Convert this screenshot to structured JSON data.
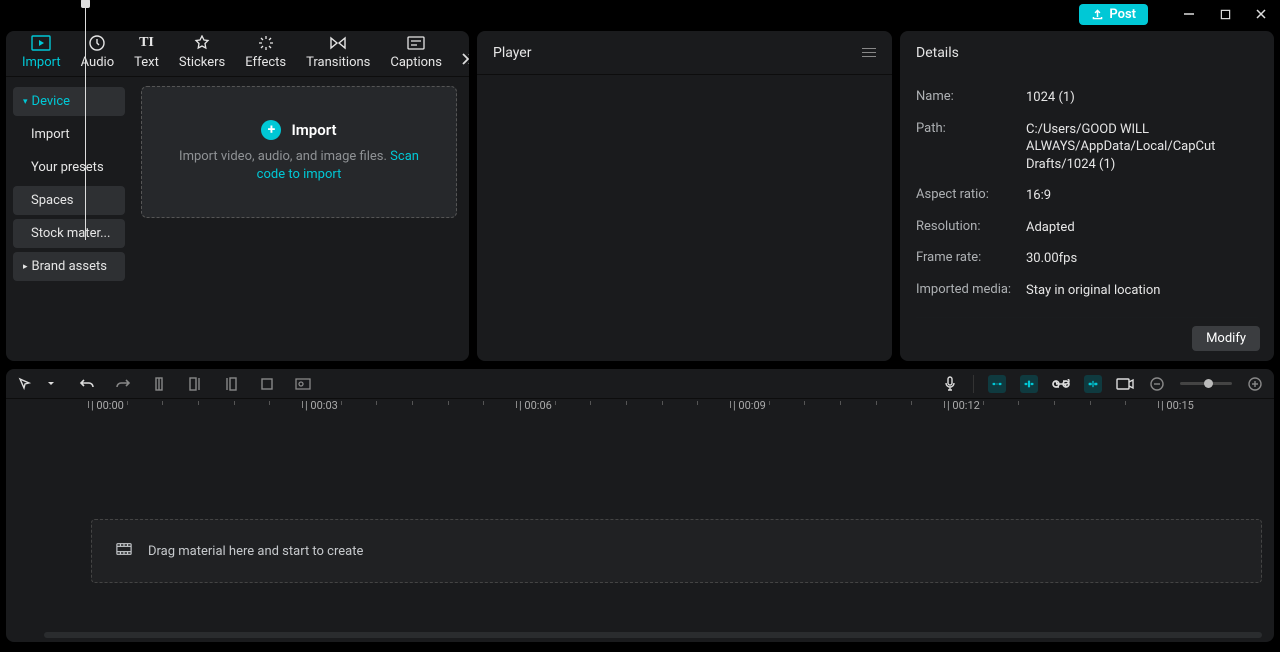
{
  "titlebar": {
    "post": "Post"
  },
  "tabs": {
    "import": "Import",
    "audio": "Audio",
    "text": "Text",
    "stickers": "Stickers",
    "effects": "Effects",
    "transitions": "Transitions",
    "captions": "Captions"
  },
  "sidenav": {
    "device": "Device",
    "import": "Import",
    "presets": "Your presets",
    "spaces": "Spaces",
    "stock": "Stock mater...",
    "brand": "Brand assets"
  },
  "importBox": {
    "title": "Import",
    "hint_prefix": "Import video, audio, and image files. ",
    "hint_link": "Scan code to import"
  },
  "player": {
    "title": "Player"
  },
  "details": {
    "title": "Details",
    "rows": {
      "name_label": "Name:",
      "name_value": "1024 (1)",
      "path_label": "Path:",
      "path_value": "C:/Users/GOOD WILL ALWAYS/AppData/Local/CapCut Drafts/1024 (1)",
      "aspect_label": "Aspect ratio:",
      "aspect_value": "16:9",
      "res_label": "Resolution:",
      "res_value": "Adapted",
      "fps_label": "Frame rate:",
      "fps_value": "30.00fps",
      "imported_label": "Imported media:",
      "imported_value": "Stay in original location"
    },
    "modify": "Modify"
  },
  "ruler": {
    "majors": [
      "00:00",
      "00:03",
      "00:06",
      "00:09",
      "00:12",
      "00:15"
    ]
  },
  "timeline": {
    "drop_hint": "Drag material here and start to create"
  }
}
